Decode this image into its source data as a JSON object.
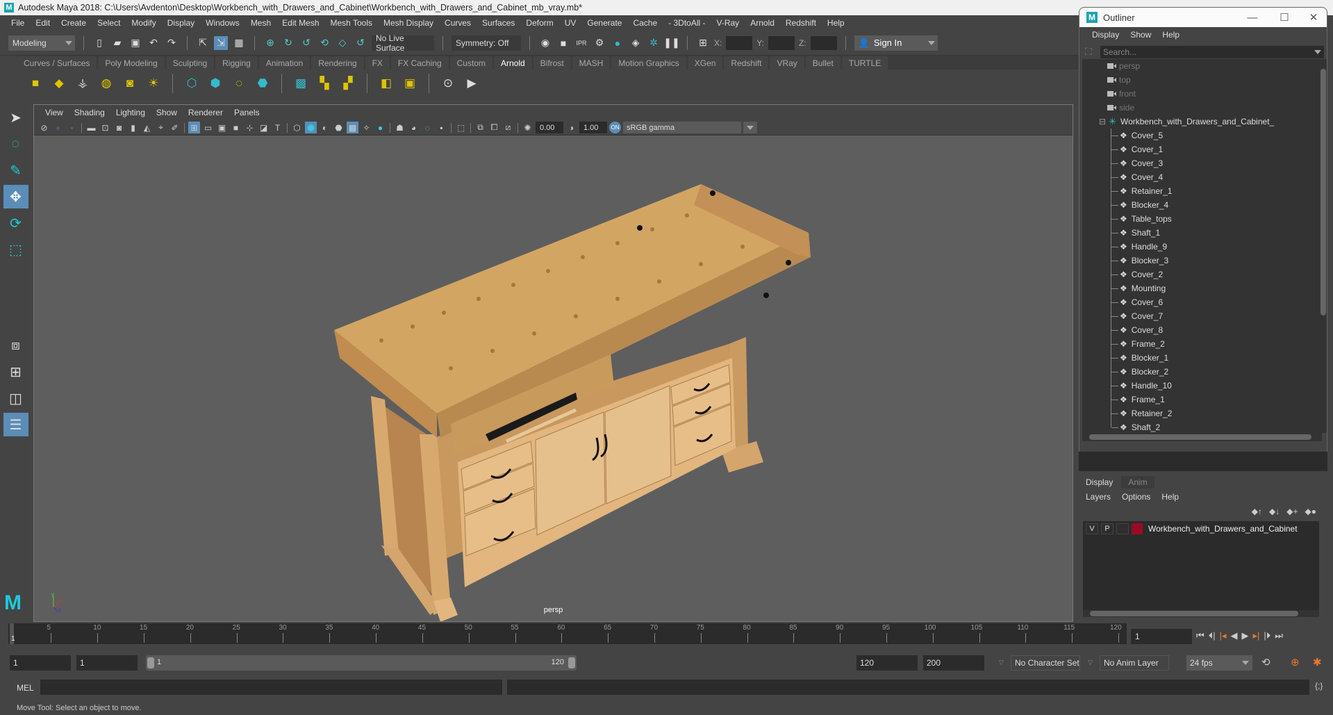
{
  "window": {
    "title": "Autodesk Maya 2018: C:\\Users\\Avdenton\\Desktop\\Workbench_with_Drawers_and_Cabinet\\Workbench_with_Drawers_and_Cabinet_mb_vray.mb*",
    "logo": "M"
  },
  "menubar": [
    "File",
    "Edit",
    "Create",
    "Select",
    "Modify",
    "Display",
    "Windows",
    "Mesh",
    "Edit Mesh",
    "Mesh Tools",
    "Mesh Display",
    "Curves",
    "Surfaces",
    "Deform",
    "UV",
    "Generate",
    "Cache",
    "- 3DtoAll -",
    "V-Ray",
    "Arnold",
    "Redshift",
    "Help"
  ],
  "statusline": {
    "workspace": "Modeling",
    "live_surface": "No Live Surface",
    "symmetry": "Symmetry: Off",
    "x_label": "X:",
    "y_label": "Y:",
    "z_label": "Z:",
    "sign_in": "Sign In"
  },
  "shelf": {
    "tabs": [
      "Curves / Surfaces",
      "Poly Modeling",
      "Sculpting",
      "Rigging",
      "Animation",
      "Rendering",
      "FX",
      "FX Caching",
      "Custom",
      "Arnold",
      "Bifrost",
      "MASH",
      "Motion Graphics",
      "XGen",
      "Redshift",
      "VRay",
      "Bullet",
      "TURTLE"
    ],
    "active_tab": "Arnold"
  },
  "panel": {
    "menu": [
      "View",
      "Shading",
      "Lighting",
      "Show",
      "Renderer",
      "Panels"
    ],
    "exposure": "0.00",
    "gamma": "1.00",
    "color_management": "sRGB gamma",
    "camera_label": "persp"
  },
  "outliner": {
    "title": "Outliner",
    "menu": [
      "Display",
      "Show",
      "Help"
    ],
    "search_placeholder": "Search...",
    "cameras": [
      "persp",
      "top",
      "front",
      "side"
    ],
    "group": "Workbench_with_Drawers_and_Cabinet_",
    "children": [
      "Cover_5",
      "Cover_1",
      "Cover_3",
      "Cover_4",
      "Retainer_1",
      "Blocker_4",
      "Table_tops",
      "Shaft_1",
      "Handle_9",
      "Blocker_3",
      "Cover_2",
      "Mounting",
      "Cover_6",
      "Cover_7",
      "Cover_8",
      "Frame_2",
      "Blocker_1",
      "Blocker_2",
      "Handle_10",
      "Frame_1",
      "Retainer_2",
      "Shaft_2"
    ]
  },
  "layers": {
    "tabs": [
      "Display",
      "Anim"
    ],
    "active_tab": "Display",
    "menu": [
      "Layers",
      "Options",
      "Help"
    ],
    "items": [
      {
        "v": "V",
        "p": "P",
        "name": "Workbench_with_Drawers_and_Cabinet",
        "color": "#9a0a24"
      }
    ]
  },
  "timeline": {
    "ticks": [
      5,
      10,
      15,
      20,
      25,
      30,
      35,
      40,
      45,
      50,
      55,
      60,
      65,
      70,
      75,
      80,
      85,
      90,
      95,
      100,
      105,
      110,
      115,
      120
    ],
    "start": 1,
    "end": 120,
    "current_frame": "1",
    "current_label": "1"
  },
  "range": {
    "start_field": "1",
    "anim_start": "1",
    "slider_start": "1",
    "slider_end": "120",
    "end_field": "120",
    "anim_end": "200",
    "character_set": "No Character Set",
    "anim_layer": "No Anim Layer",
    "fps": "24 fps"
  },
  "command": {
    "mel_label": "MEL"
  },
  "help_line": "Move Tool: Select an object to move."
}
